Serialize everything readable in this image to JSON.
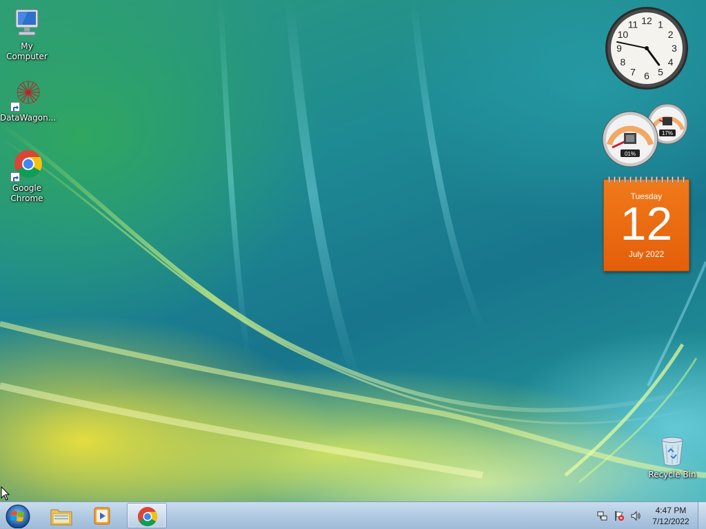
{
  "desktop": {
    "icons": [
      {
        "label": "My Computer"
      },
      {
        "label": "DataWagon..."
      },
      {
        "label": "Google Chrome"
      },
      {
        "label": "Recycle Bin"
      }
    ]
  },
  "gadgets": {
    "clock": {
      "hour": 4,
      "minute": 47,
      "numerals": [
        "12",
        "1",
        "2",
        "3",
        "4",
        "5",
        "6",
        "7",
        "8",
        "9",
        "10",
        "11"
      ]
    },
    "cpu_meter": {
      "cpu": "01%",
      "memory": "17%"
    },
    "calendar": {
      "weekday": "Tuesday",
      "day": "12",
      "month_year": "July 2022"
    }
  },
  "taskbar": {
    "pinned": [
      {
        "name": "Windows Explorer",
        "icon": "folder-icon"
      },
      {
        "name": "Windows Media Player",
        "icon": "media-player-icon"
      },
      {
        "name": "Google Chrome",
        "icon": "chrome-icon",
        "active": true
      }
    ],
    "tray": {
      "time": "4:47 PM",
      "date": "7/12/2022",
      "icons": [
        "network-icon",
        "action-center-flag-icon",
        "volume-icon"
      ]
    }
  },
  "colors": {
    "calendar_orange": "#e8661a",
    "taskbar": "#b3cbe3",
    "chrome_red": "#db4437",
    "chrome_yellow": "#f4c20d",
    "chrome_green": "#0f9d58",
    "chrome_blue": "#4285f4"
  }
}
